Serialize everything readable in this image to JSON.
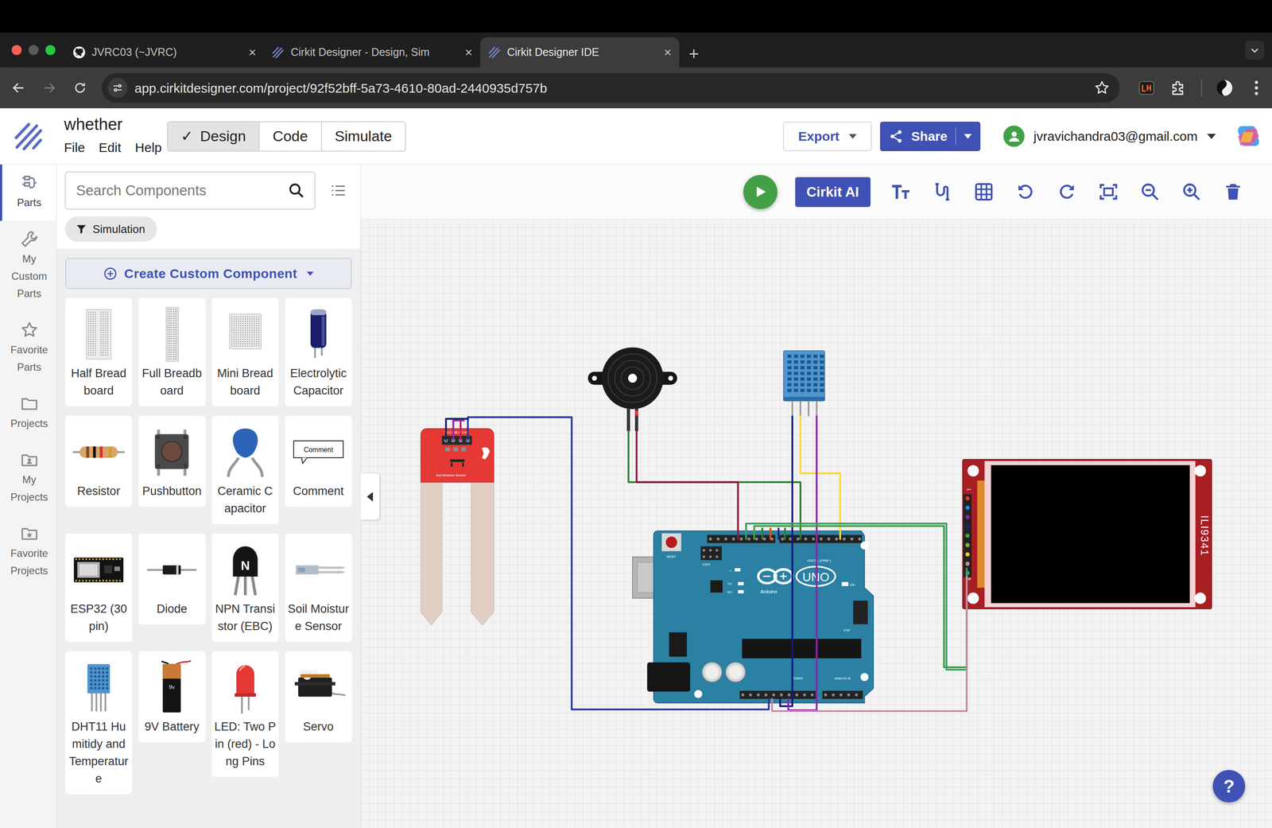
{
  "browser": {
    "tabs": [
      {
        "label": "JVRC03 (~JVRC)",
        "selected": false,
        "kind": "github"
      },
      {
        "label": "Cirkit Designer - Design, Sim",
        "selected": false,
        "kind": "cirkit"
      },
      {
        "label": "Cirkit Designer IDE",
        "selected": true,
        "kind": "cirkit"
      }
    ],
    "close_glyph": "×",
    "new_tab_glyph": "+",
    "url": "app.cirkitdesigner.com/project/92f52bff-5a73-4610-80ad-2440935d757b"
  },
  "app": {
    "project_name": "whether",
    "menu": [
      "File",
      "Edit",
      "Help"
    ],
    "check_glyph": "✓",
    "modes": [
      {
        "label": "Design",
        "selected": true
      },
      {
        "label": "Code",
        "selected": false
      },
      {
        "label": "Simulate",
        "selected": false
      }
    ],
    "export": "Export",
    "share": "Share",
    "account": "jvravichandra03@gmail.com"
  },
  "rail": [
    {
      "label": "Parts",
      "selected": true,
      "kind": "parts"
    },
    {
      "label": "My Custom Parts",
      "selected": false,
      "kind": "wrench"
    },
    {
      "label": "Favorite Parts",
      "selected": false,
      "kind": "star"
    },
    {
      "label": "Projects",
      "selected": false,
      "kind": "folder"
    },
    {
      "label": "My Projects",
      "selected": false,
      "kind": "folder-user"
    },
    {
      "label": "Favorite Projects",
      "selected": false,
      "kind": "folder-star"
    }
  ],
  "parts_panel": {
    "search_placeholder": "Search Components",
    "filter": "Simulation",
    "create": "Create Custom Component",
    "parts": [
      {
        "label": "Half Breadboard",
        "kind": "breadboard-half"
      },
      {
        "label": "Full Breadboard",
        "kind": "breadboard-full"
      },
      {
        "label": "Mini Breadboard",
        "kind": "breadboard-mini"
      },
      {
        "label": "Electrolytic Capacitor",
        "kind": "capacitor-electrolytic"
      },
      {
        "label": "Resistor",
        "kind": "resistor"
      },
      {
        "label": "Pushbutton",
        "kind": "pushbutton"
      },
      {
        "label": "Ceramic Capacitor",
        "kind": "capacitor-ceramic"
      },
      {
        "label": "Comment",
        "kind": "comment",
        "icon_text": "Comment"
      },
      {
        "label": "ESP32 (30 pin)",
        "kind": "esp32"
      },
      {
        "label": "Diode",
        "kind": "diode"
      },
      {
        "label": "NPN Transistor (EBC)",
        "kind": "npn",
        "icon_text": "N"
      },
      {
        "label": "Soil Moisture Sensor",
        "kind": "soil"
      },
      {
        "label": "DHT11 Humitidy and Temperature",
        "kind": "dht11"
      },
      {
        "label": "9V Battery",
        "kind": "battery",
        "icon_text": "9v"
      },
      {
        "label": "LED: Two Pin (red) - Long Pins",
        "kind": "led"
      },
      {
        "label": "Servo",
        "kind": "servo"
      }
    ]
  },
  "toolbar": {
    "ai": "Cirkit AI"
  },
  "canvas": {
    "soil_sensor": {
      "pins": "VCC GND DO AO",
      "label": "Soil Moisture Sensor"
    },
    "arduino": {
      "reset": "RESET",
      "icsp2": "ICSP2",
      "l": "L",
      "tx": "TX",
      "rx": "RX",
      "brand": "Arduino",
      "model": "UNO",
      "digital": "DIGITAL (PWM~)",
      "on": "ON",
      "icsp": "ICSP",
      "power": "POWER",
      "analog": "ANALOG IN"
    },
    "display": {
      "model": "ILI9341",
      "pin_first": "1",
      "pin_last": "9"
    }
  },
  "help": "?"
}
